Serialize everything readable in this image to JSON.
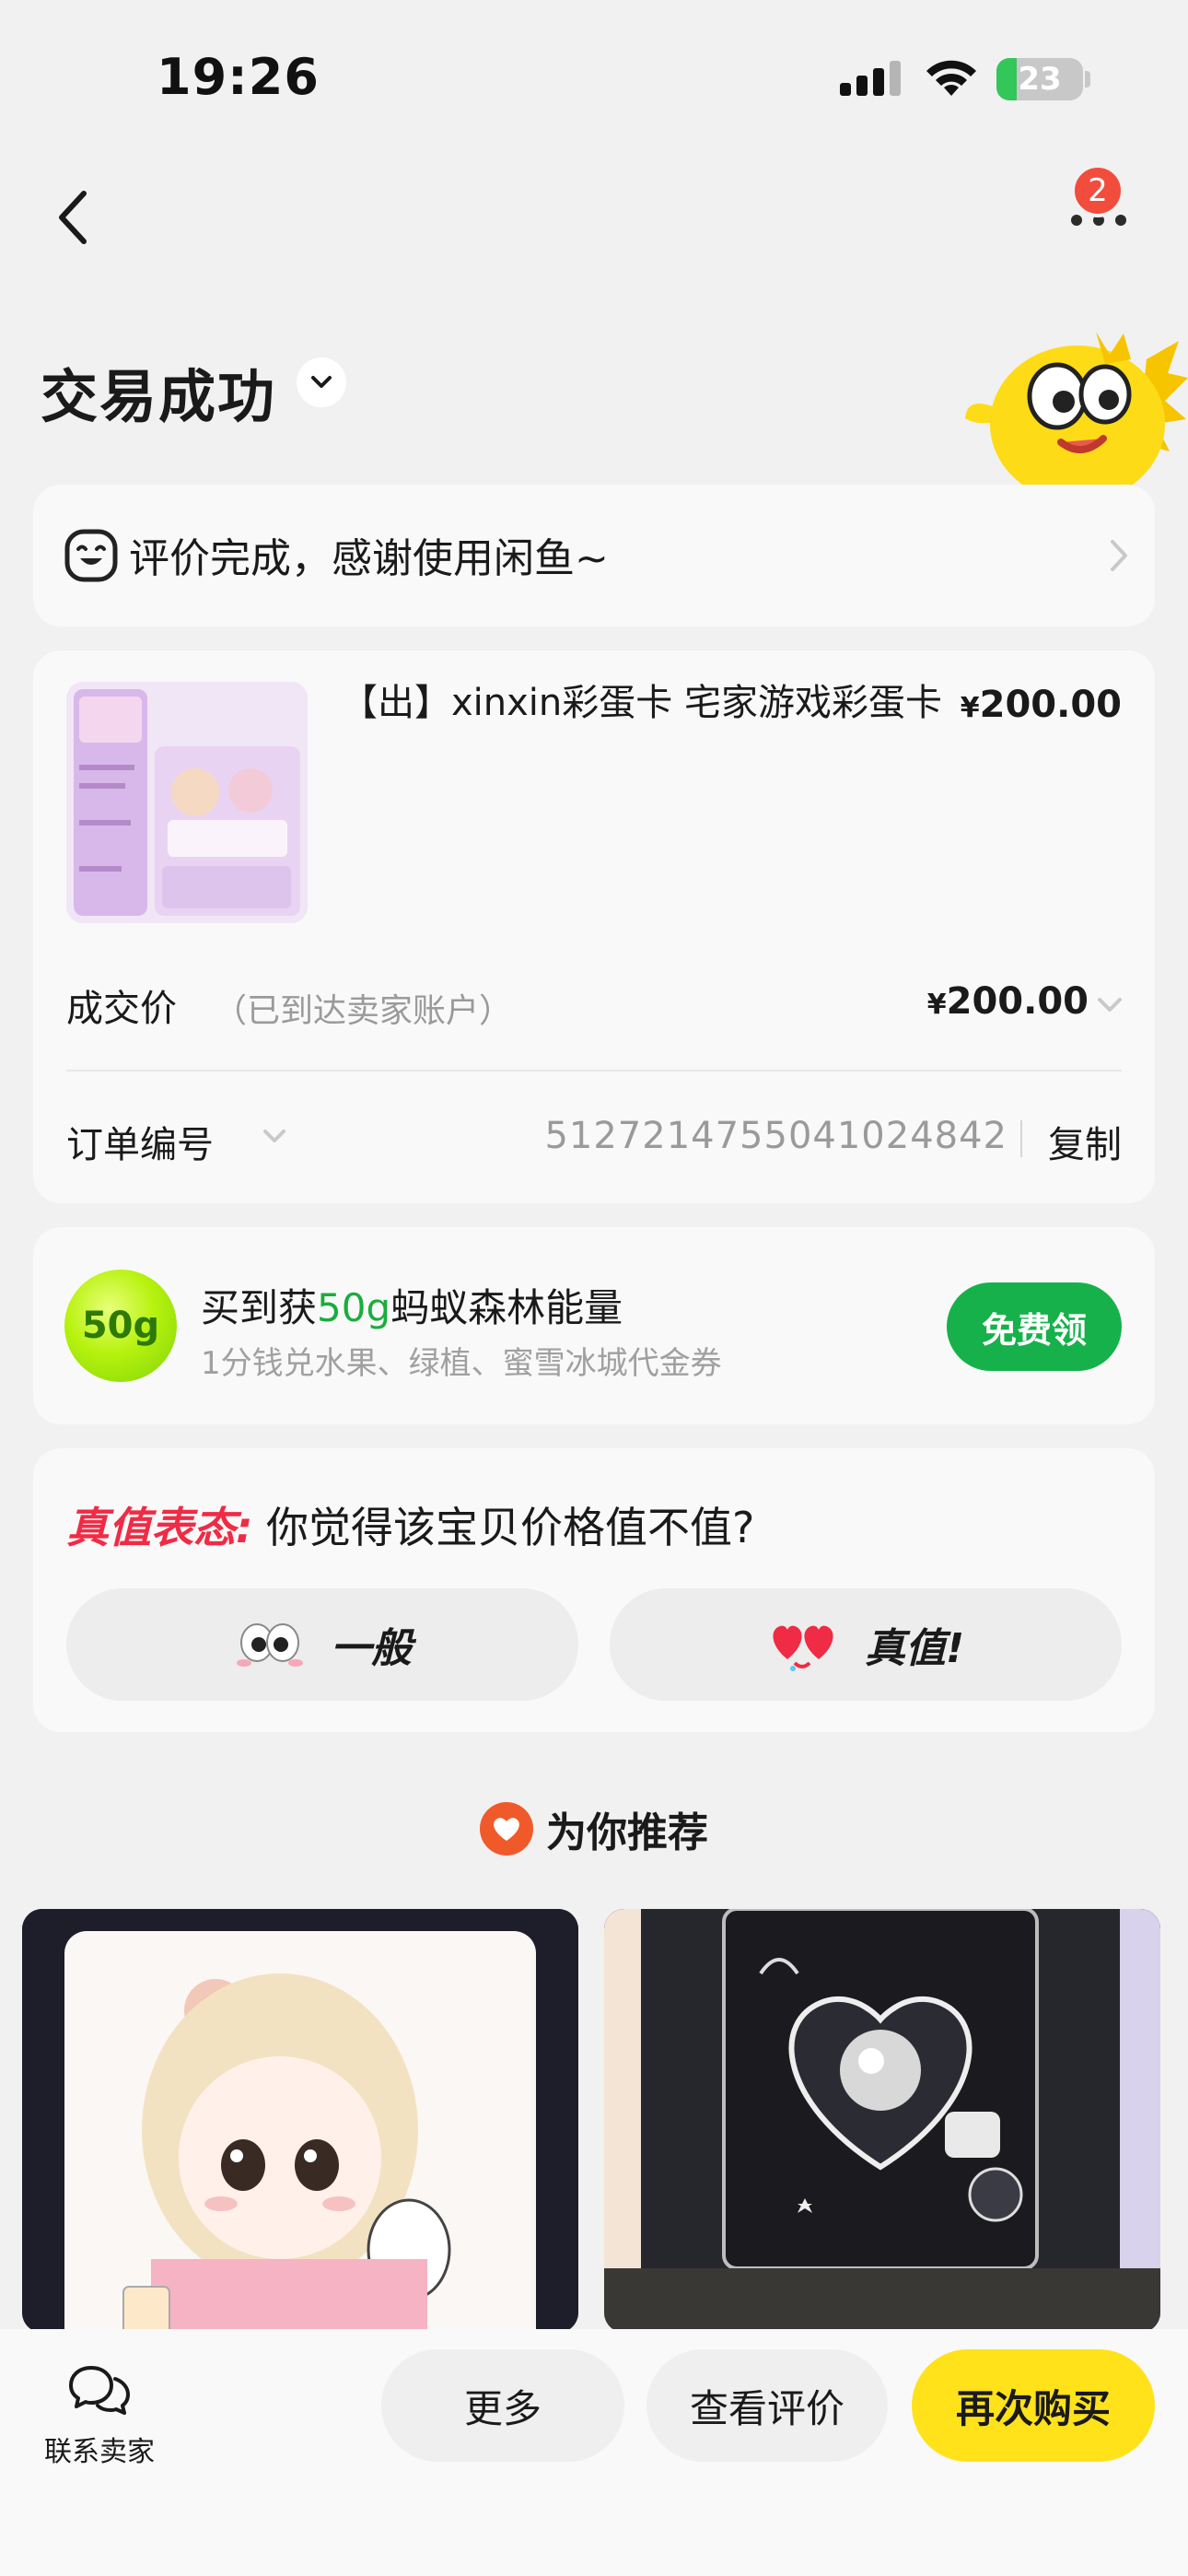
{
  "status": {
    "time": "19:26",
    "battery": "23",
    "battery_level": 0.23
  },
  "nav": {
    "notification_count": "2"
  },
  "page": {
    "title": "交易成功"
  },
  "review_banner": {
    "text": "评价完成，感谢使用闲鱼~"
  },
  "order": {
    "product_title": "【出】xinxin彩蛋卡 宅家游戏彩蛋卡",
    "product_price": "200.00",
    "currency": "¥",
    "deal_label": "成交价",
    "deal_note": "（已到达卖家账户）",
    "deal_price": "200.00",
    "order_label": "订单编号",
    "order_number": "5127214755041024842",
    "copy_label": "复制"
  },
  "energy": {
    "badge": "50g",
    "title_pre": "买到获",
    "title_hl": "50g",
    "title_post": "蚂蚁森林能量",
    "subtitle": "1分钱兑水果、绿植、蜜雪冰城代金券",
    "claim_label": "免费领"
  },
  "value_poll": {
    "tag": "真值表态:",
    "question": " 你觉得该宝贝价格值不值?",
    "option_meh": "一般",
    "option_worth": "真值!"
  },
  "recommend": {
    "title": "为你推荐"
  },
  "bottom_bar": {
    "contact_label": "联系卖家",
    "more_label": "更多",
    "review_label": "查看评价",
    "rebuy_label": "再次购买"
  },
  "colors": {
    "accent_yellow": "#ffe21a",
    "claim_green": "#16b14a",
    "value_red": "#f02b45",
    "battery_green": "#33c759"
  },
  "icons": [
    "back-arrow-icon",
    "more-dots-icon",
    "chevron-down-icon",
    "smile-icon",
    "chevron-right-icon",
    "eyes-emoji-icon",
    "heart-eyes-emoji-icon",
    "heart-icon",
    "chat-bubble-icon"
  ]
}
